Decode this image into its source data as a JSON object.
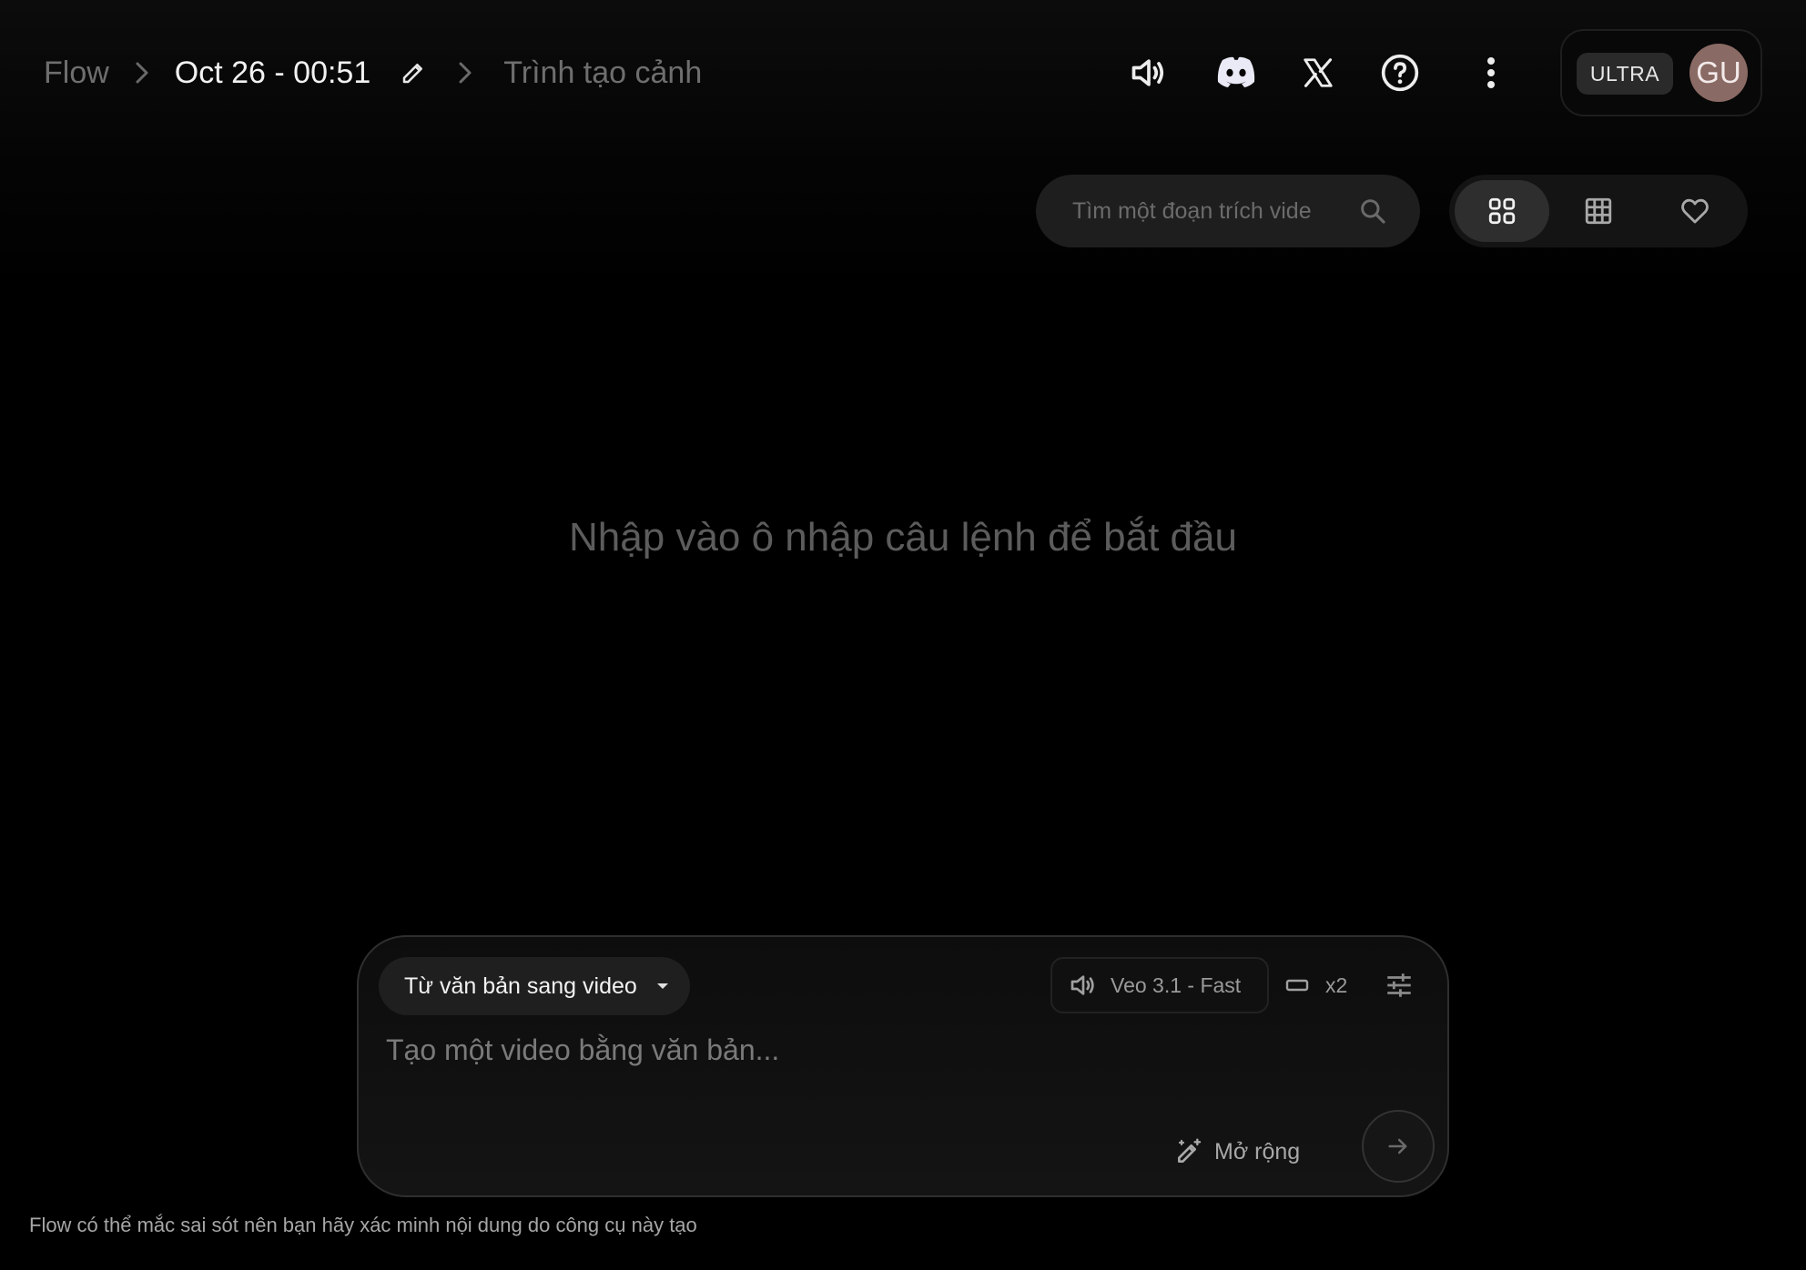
{
  "breadcrumb": {
    "root": "Flow",
    "project": "Oct 26 - 00:51",
    "scene": "Trình tạo cảnh"
  },
  "header": {
    "icons": [
      "volume-icon",
      "discord-icon",
      "x-logo-icon",
      "help-icon",
      "more-vert-icon"
    ],
    "plan_badge": "ULTRA",
    "avatar_initials": "GU",
    "avatar_color": "#8a6a64"
  },
  "toolbar": {
    "search_placeholder": "Tìm một đoạn trích video",
    "view_modes": [
      "grid-large-icon",
      "grid-small-icon",
      "favorite-icon"
    ],
    "active_view": "grid-large-icon"
  },
  "empty_state": {
    "message": "Nhập vào ô nhập câu lệnh để bắt đầu"
  },
  "composer": {
    "mode": "Từ văn bản sang video",
    "model": "Veo 3.1 - Fast",
    "output_count": "x2",
    "prompt_placeholder": "Tạo một video bằng văn bản...",
    "expand_label": "Mở rộng"
  },
  "footer": {
    "disclaimer": "Flow có thể mắc sai sót nên bạn hãy xác minh nội dung do công cụ này tạo"
  }
}
